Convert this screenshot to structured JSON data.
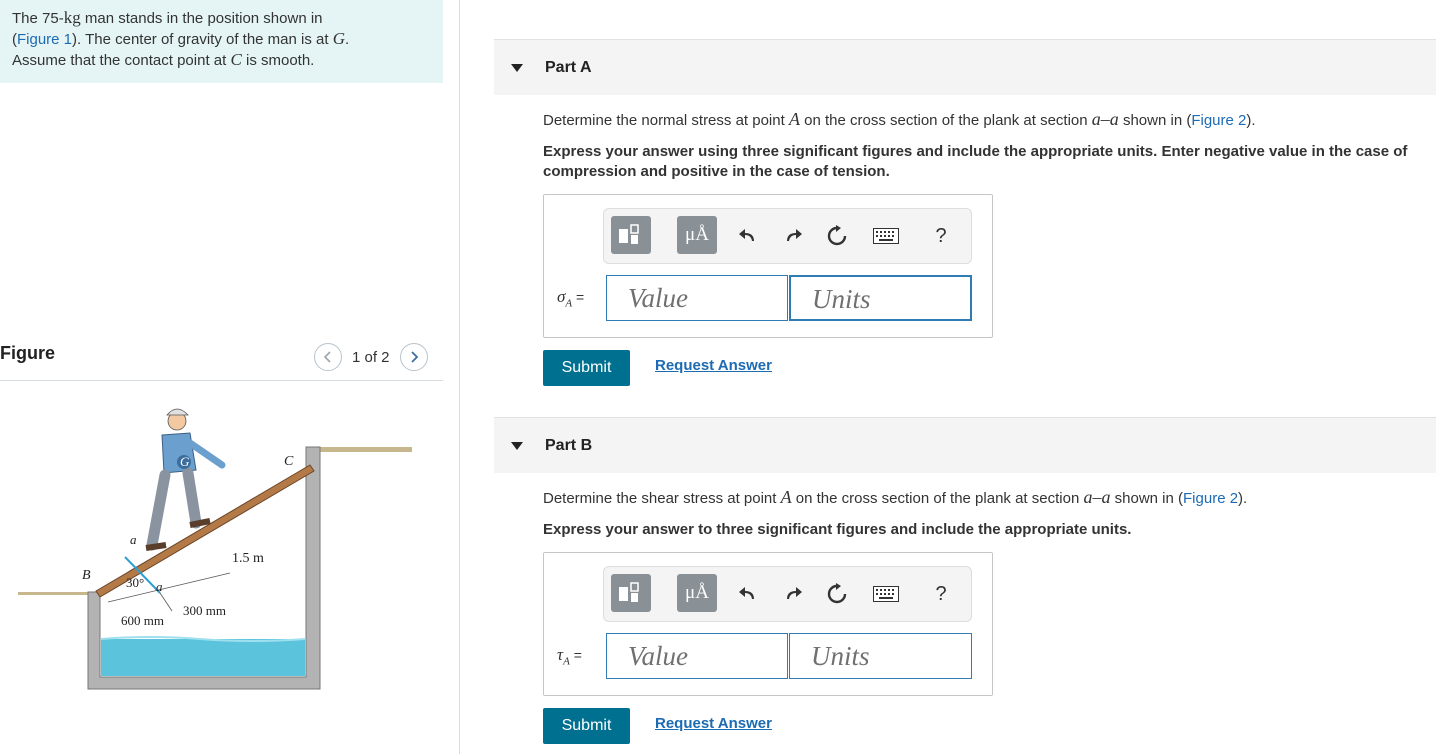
{
  "problem": {
    "s1": "The 75-",
    "unit": "kg",
    "s2": " man stands in the position shown in",
    "s3": "(",
    "fig1": "Figure 1",
    "s4": "). The center of gravity of the man is at ",
    "g": "G",
    "s5": ".",
    "s6": "Assume that the contact point at ",
    "c": "C",
    "s7": " is smooth."
  },
  "figure_panel": {
    "title": "Figure",
    "pager": "1 of 2",
    "labels": {
      "b": "B",
      "a1": "a",
      "a2": "a",
      "c": "C",
      "g": "G",
      "angle": "30°",
      "length": "1.5 m",
      "dim1": "300 mm",
      "dim2": "600 mm"
    }
  },
  "part_a": {
    "title": "Part A",
    "q1": "Determine the normal stress at point ",
    "pt": "A",
    "q2": " on the cross section of the plank at section ",
    "sec": "a–a",
    "q3": " shown in (",
    "fig": "Figure 2",
    "q4": ").",
    "instruction": "Express your answer using three significant figures and include the appropriate units. Enter negative value in the case of compression and positive in the case of tension.",
    "symbol": "σ",
    "sub": "A",
    "eq": " =",
    "value_placeholder": "Value",
    "units_placeholder": "Units",
    "submit": "Submit",
    "request": "Request Answer"
  },
  "part_b": {
    "title": "Part B",
    "q1": "Determine the shear stress at point ",
    "pt": "A",
    "q2": " on the cross section of the plank at section ",
    "sec": "a–a",
    "q3": " shown in (",
    "fig": "Figure 2",
    "q4": ").",
    "instruction": "Express your answer to three significant figures and include the appropriate units.",
    "symbol": "τ",
    "sub": "A",
    "eq": " =",
    "value_placeholder": "Value",
    "units_placeholder": "Units",
    "submit": "Submit",
    "request": "Request Answer"
  },
  "toolbar": {
    "units_btn": "μÅ",
    "help": "?"
  },
  "colors": {
    "accent": "#007090",
    "link": "#1c6bb3",
    "field_border": "#2e7cb3",
    "problem_bg": "#e5f5f6",
    "water": "#5bc4dc"
  }
}
